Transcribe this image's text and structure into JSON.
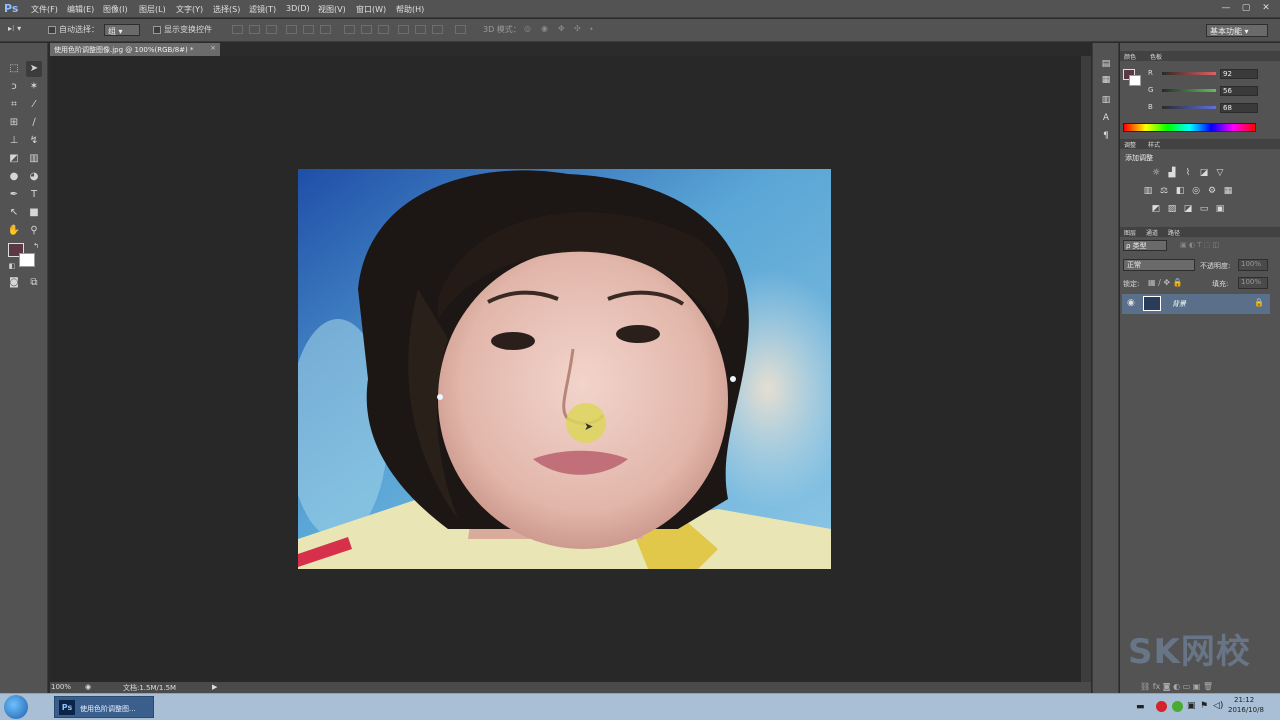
{
  "app": {
    "logo": "Ps",
    "menu": [
      "文件(F)",
      "编辑(E)",
      "图像(I)",
      "图层(L)",
      "文字(Y)",
      "选择(S)",
      "滤镜(T)",
      "3D(D)",
      "视图(V)",
      "窗口(W)",
      "帮助(H)"
    ],
    "window_buttons": [
      "—",
      "▢",
      "✕"
    ]
  },
  "options": {
    "auto_select_label": "自动选择：",
    "auto_select_value": "组",
    "show_transform_label": "显示变换控件",
    "mode_3d_label": "3D 模式：",
    "workspace": "基本功能"
  },
  "document": {
    "tab_title": "使用色阶调整图像.jpg @ 100%(RGB/8#) *",
    "close": "×"
  },
  "status": {
    "zoom": "100%",
    "doc_info": "文档:1.5M/1.5M"
  },
  "color_panel": {
    "tabs": [
      "颜色",
      "色板"
    ],
    "channels": [
      {
        "label": "R",
        "value": "92",
        "color": "#e06060"
      },
      {
        "label": "G",
        "value": "56",
        "color": "#60c060"
      },
      {
        "label": "B",
        "value": "68",
        "color": "#6070e0"
      }
    ],
    "foreground_color": "#5c3844",
    "background_color": "#ffffff"
  },
  "adjustments_panel": {
    "tabs": [
      "调整",
      "样式"
    ],
    "title": "添加调整"
  },
  "layers_panel": {
    "tabs": [
      "图层",
      "通道",
      "路径"
    ],
    "filter_label": "ρ 类型",
    "blend_mode": "正常",
    "opacity_label": "不透明度:",
    "opacity_value": "100%",
    "lock_label": "锁定:",
    "fill_label": "填充:",
    "fill_value": "100%",
    "layers": [
      {
        "name": "背景",
        "visible": true,
        "locked": true
      }
    ]
  },
  "taskbar": {
    "ps_task_label": "使用色阶调整图...",
    "time": "21:12",
    "date": "2016/10/8"
  },
  "watermark": "SK网校"
}
